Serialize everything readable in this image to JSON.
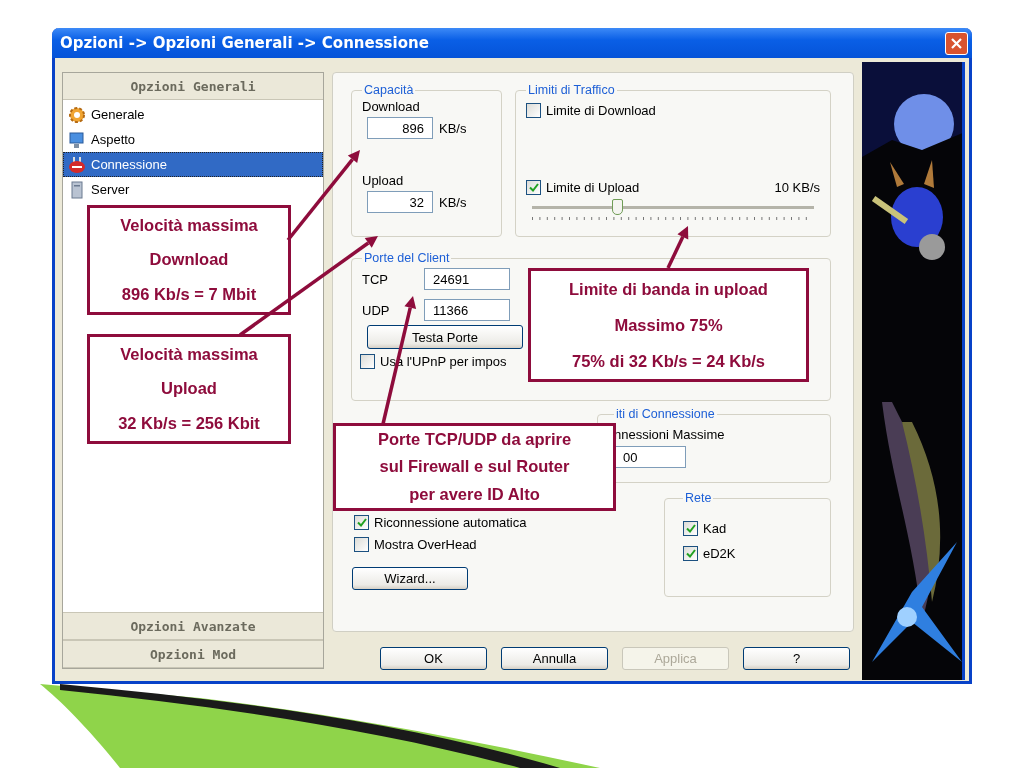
{
  "window": {
    "title": "Opzioni -> Opzioni Generali -> Connessione"
  },
  "sidebar": {
    "header": "Opzioni Generali",
    "items": [
      {
        "label": "Generale",
        "kind": "gear",
        "selected": false
      },
      {
        "label": "Aspetto",
        "kind": "monitor",
        "selected": false
      },
      {
        "label": "Connessione",
        "kind": "plug",
        "selected": true
      },
      {
        "label": "Server",
        "kind": "tower",
        "selected": false
      }
    ],
    "footer_sections": [
      "Opzioni Avanzate",
      "Opzioni Mod"
    ]
  },
  "capacity": {
    "title": "Capacità",
    "fields": [
      {
        "label": "Download",
        "value": "896",
        "unit": "KB/s"
      },
      {
        "label": "Upload",
        "value": "32",
        "unit": "KB/s"
      }
    ]
  },
  "traffic_limits": {
    "title": "Limiti di Traffico",
    "download_limit": {
      "label": "Limite di Download",
      "checked": false
    },
    "upload_limit": {
      "label": "Limite di Upload",
      "checked": true,
      "reading": "10 KB/s",
      "level": 0.3
    }
  },
  "client_ports": {
    "title": "Porte del Client",
    "ports": [
      {
        "label": "TCP",
        "value": "24691"
      },
      {
        "label": "UDP",
        "value": "11366"
      }
    ],
    "test_button": "Testa Porte",
    "upnp": {
      "label": "Usa l'UPnP per impos",
      "checked": false
    }
  },
  "connection_limits": {
    "title": "iti di Connessione",
    "label": "nnessioni Massime",
    "value": "00"
  },
  "options": [
    {
      "label": "Riconnessione automatica",
      "checked": true
    },
    {
      "label": "Mostra OverHead",
      "checked": false
    }
  ],
  "wizard_button": "Wizard...",
  "network": {
    "title": "Rete",
    "items": [
      {
        "label": "Kad",
        "checked": true
      },
      {
        "label": "eD2K",
        "checked": true
      }
    ]
  },
  "buttons": [
    {
      "label": "OK",
      "disabled": false
    },
    {
      "label": "Annulla",
      "disabled": false
    },
    {
      "label": "Applica",
      "disabled": true
    },
    {
      "label": "?",
      "disabled": false
    }
  ],
  "callouts": [
    {
      "lines": [
        "Velocità massima",
        "Download",
        "896 Kb/s = 7 Mbit"
      ]
    },
    {
      "lines": [
        "Velocità massima",
        "Upload",
        "32 Kb/s = 256 Kbit"
      ]
    },
    {
      "lines": [
        "Limite di banda in upload",
        "Massimo 75%",
        "75% di 32 Kb/s = 24 Kb/s"
      ]
    },
    {
      "lines": [
        "Porte TCP/UDP da aprire",
        "sul Firewall e sul Router",
        "per avere ID Alto"
      ]
    }
  ]
}
